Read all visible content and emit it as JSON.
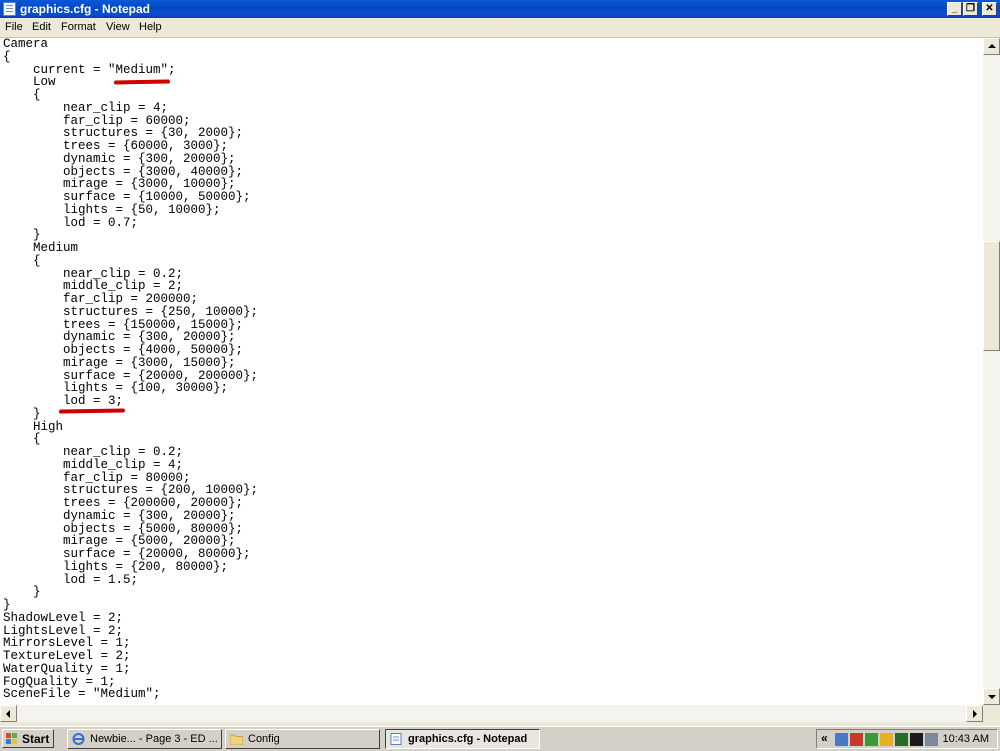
{
  "window": {
    "title": "graphics.cfg - Notepad",
    "buttons": {
      "minimize": "_",
      "maximize": "❐",
      "close": "✕"
    }
  },
  "menu": [
    "File",
    "Edit",
    "Format",
    "View",
    "Help"
  ],
  "editor": {
    "lines": [
      "Camera",
      "{",
      "    current = \"Medium\";",
      "    Low",
      "    {",
      "        near_clip = 4;",
      "        far_clip = 60000;",
      "        structures = {30, 2000};",
      "        trees = {60000, 3000};",
      "        dynamic = {300, 20000};",
      "        objects = {3000, 40000};",
      "        mirage = {3000, 10000};",
      "        surface = {10000, 50000};",
      "        lights = {50, 10000};",
      "        lod = 0.7;",
      "    }",
      "    Medium",
      "    {",
      "        near_clip = 0.2;",
      "        middle_clip = 2;",
      "        far_clip = 200000;",
      "        structures = {250, 10000};",
      "        trees = {150000, 15000};",
      "        dynamic = {300, 20000};",
      "        objects = {4000, 50000};",
      "        mirage = {3000, 15000};",
      "        surface = {20000, 200000};",
      "        lights = {100, 30000};",
      "        lod = 3;",
      "    }",
      "    High",
      "    {",
      "        near_clip = 0.2;",
      "        middle_clip = 4;",
      "        far_clip = 80000;",
      "        structures = {200, 10000};",
      "        trees = {200000, 20000};",
      "        dynamic = {300, 20000};",
      "        objects = {5000, 80000};",
      "        mirage = {5000, 20000};",
      "        surface = {20000, 80000};",
      "        lights = {200, 80000};",
      "        lod = 1.5;",
      "    }",
      "}",
      "ShadowLevel = 2;",
      "LightsLevel = 2;",
      "MirrorsLevel = 1;",
      "TextureLevel = 2;",
      "WaterQuality = 1;",
      "FogQuality = 1;",
      "SceneFile = \"Medium\";"
    ]
  },
  "taskbar": {
    "start_label": "Start",
    "tasks": [
      {
        "label": "Newbie... - Page 3 - ED ...",
        "icon": "ie-icon",
        "active": false
      },
      {
        "label": "Config",
        "icon": "folder-icon",
        "active": false
      },
      {
        "label": "graphics.cfg - Notepad",
        "icon": "notepad-icon",
        "active": true
      }
    ],
    "tray_expand": "«",
    "clock": "10:43 AM"
  },
  "colors": {
    "titlebar": "#0548c4",
    "annotation_red": "#d00000",
    "chrome": "#ECE9D8"
  }
}
